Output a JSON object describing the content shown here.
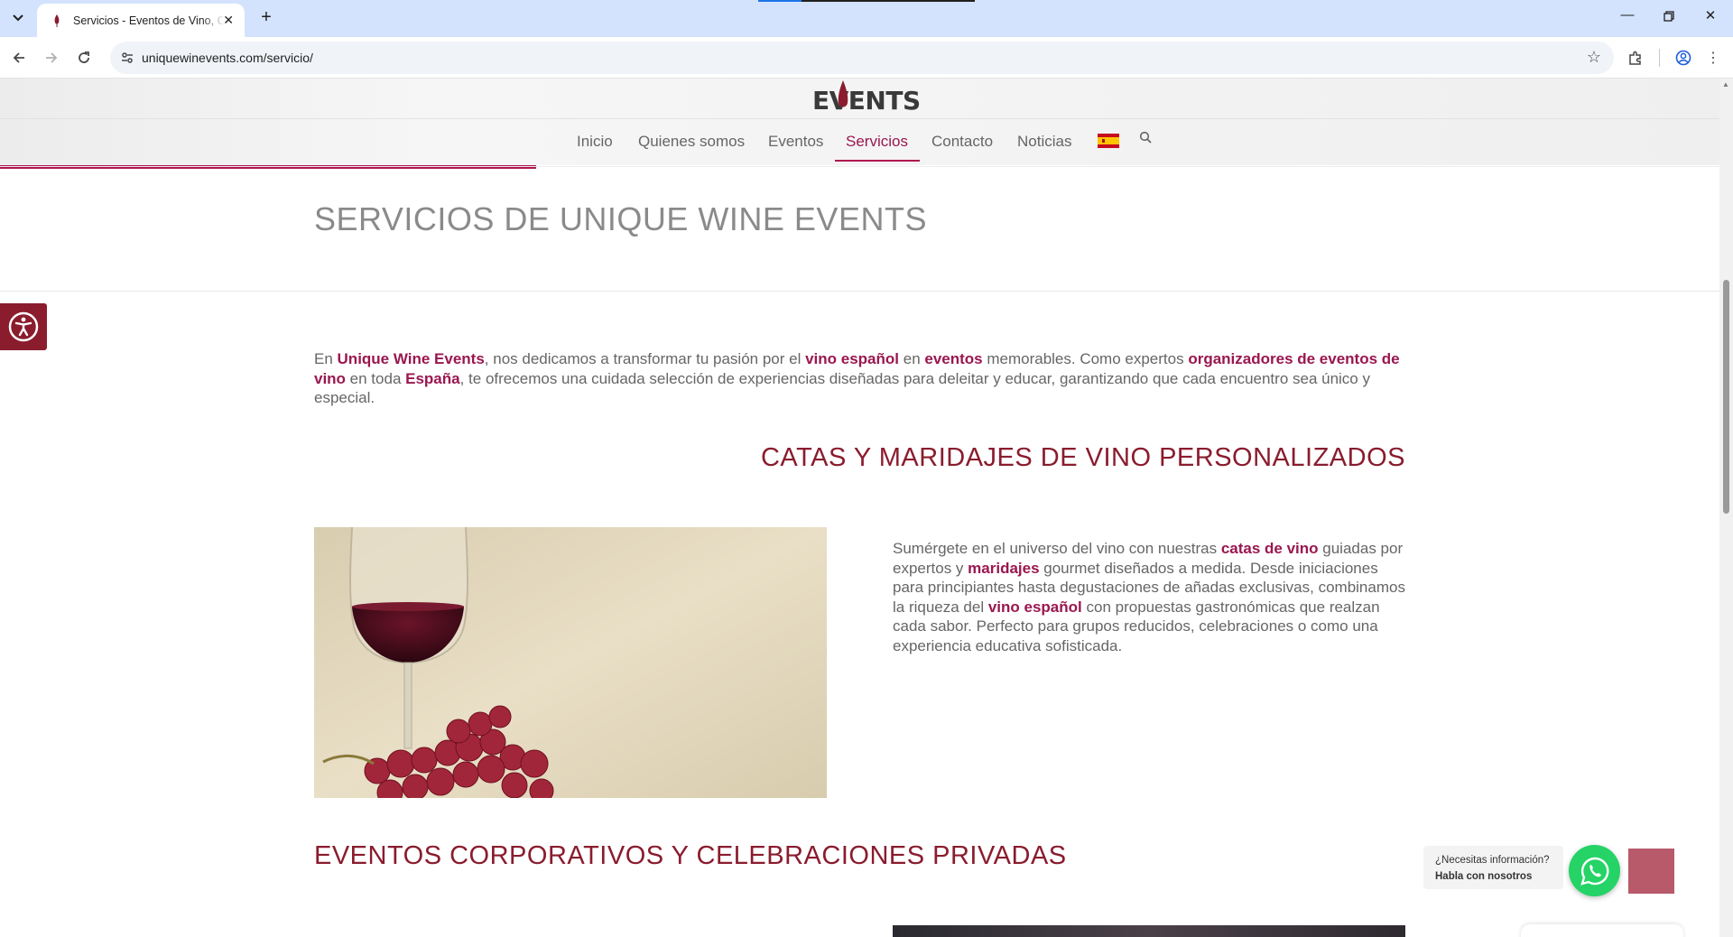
{
  "browser": {
    "tab_title": "Servicios - Eventos de Vino, Catas",
    "url": "uniquewinevents.com/servicio/"
  },
  "site": {
    "logo_text": "EVENTS",
    "menu": [
      "Inicio",
      "Quienes somos",
      "Eventos",
      "Servicios",
      "Contacto",
      "Noticias"
    ],
    "active_menu": "Servicios",
    "brand_color": "#9a1750",
    "heading_color": "#8a1c2e"
  },
  "page": {
    "title": "SERVICIOS DE UNIQUE WINE EVENTS",
    "intro": {
      "t1": "En ",
      "l1": "Unique Wine Events",
      "t2": ", nos dedicamos a transformar tu pasión por el ",
      "l2": "vino español",
      "t3": " en ",
      "l3": "eventos",
      "t4": " memorables. Como expertos ",
      "l4": "organizadores de eventos de vino",
      "t5": " en toda ",
      "l5": "España",
      "t6": ", te ofrecemos una cuidada selección de experiencias diseñadas para deleitar y educar, garantizando que cada encuentro sea único y especial."
    },
    "section1": {
      "heading": "CATAS Y MARIDAJES DE VINO PERSONALIZADOS",
      "t1": "Sumérgete en el universo del vino con nuestras ",
      "l1": "catas de vino",
      "t2": " guiadas por expertos y ",
      "l2": "maridajes",
      "t3": " gourmet diseñados a medida. Desde iniciaciones para principiantes hasta degustaciones de añadas exclusivas, combinamos la riqueza del ",
      "l3": "vino español",
      "t4": " con propuestas gastronómicas que realzan cada sabor. Perfecto para grupos reducidos, celebraciones o como una experiencia educativa sofisticada."
    },
    "section2": {
      "heading": "EVENTOS CORPORATIVOS Y CELEBRACIONES PRIVADAS"
    }
  },
  "whatsapp": {
    "line1": "¿Necesitas información?",
    "line2": "Habla con nosotros"
  },
  "icons": [
    "tab-list-icon",
    "wine-favicon",
    "close-icon",
    "new-tab-icon",
    "minimize-icon",
    "restore-icon",
    "window-close-icon",
    "back-icon",
    "forward-icon",
    "reload-icon",
    "site-info-icon",
    "bookmark-star-icon",
    "extensions-icon",
    "profile-icon",
    "kebab-menu-icon",
    "spain-flag-icon",
    "search-icon",
    "accessibility-icon",
    "whatsapp-icon"
  ]
}
